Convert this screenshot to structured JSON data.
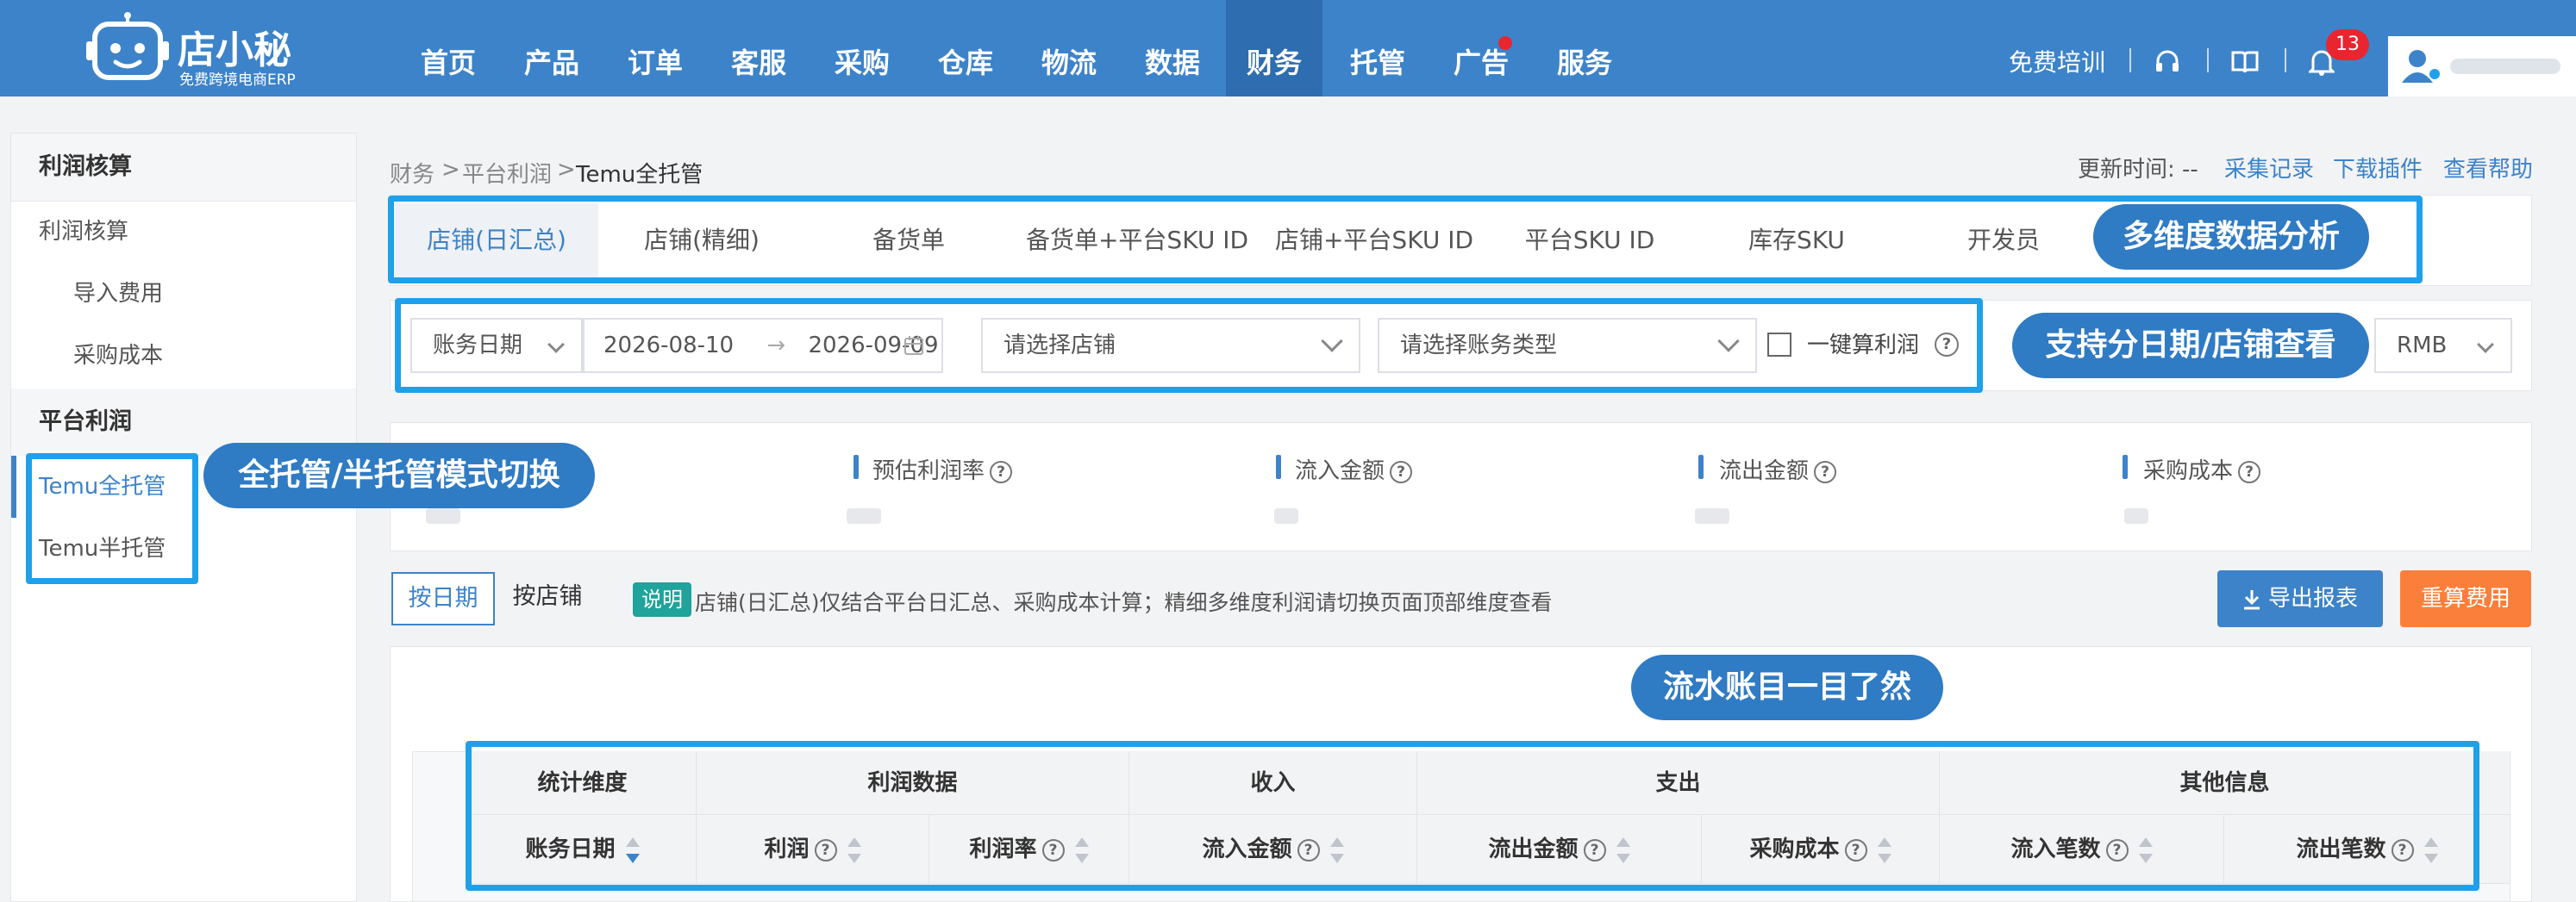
{
  "app": {
    "logo_title": "店小秘",
    "logo_subtitle": "免费跨境电商ERP"
  },
  "nav": {
    "items": [
      "首页",
      "产品",
      "订单",
      "客服",
      "采购",
      "仓库",
      "物流",
      "数据",
      "财务",
      "托管",
      "广告",
      "服务"
    ],
    "active": "财务"
  },
  "topbar": {
    "training": "免费培训",
    "notification_count": "13"
  },
  "sidebar": {
    "section1": "利润核算",
    "items1": [
      "利润核算",
      "导入费用",
      "采购成本"
    ],
    "section2": "平台利润",
    "items2": [
      "Temu全托管",
      "Temu半托管"
    ]
  },
  "breadcrumb": {
    "l1": "财务",
    "l2": "平台利润",
    "current": "Temu全托管",
    "sep": ">"
  },
  "meta": {
    "update_time": "更新时间: --",
    "links": [
      "采集记录",
      "下载插件",
      "查看帮助"
    ]
  },
  "tabs": [
    "店铺(日汇总)",
    "店铺(精细)",
    "备货单",
    "备货单+平台SKU ID",
    "店铺+平台SKU ID",
    "平台SKU ID",
    "库存SKU",
    "开发员"
  ],
  "filters": {
    "date_type": "账务日期",
    "date_start": "2026-08-10",
    "date_end": "2026-09-09",
    "arrow": "→",
    "store_placeholder": "请选择店铺",
    "account_placeholder": "请选择账务类型",
    "one_click": "一键算利润",
    "currency": "RMB"
  },
  "stats": [
    "预估利润率",
    "流入金额",
    "流出金额",
    "采购成本"
  ],
  "view_toggle": {
    "by_date": "按日期",
    "by_store": "按店铺"
  },
  "note": {
    "tag": "说明",
    "text": "店铺(日汇总)仅结合平台日汇总、采购成本计算；精细多维度利润请切换页面顶部维度查看"
  },
  "buttons": {
    "export": "导出报表",
    "recalc": "重算费用"
  },
  "table": {
    "groups": [
      "统计维度",
      "利润数据",
      "收入",
      "支出",
      "其他信息"
    ],
    "columns": [
      "账务日期",
      "利润",
      "利润率",
      "流入金额",
      "流出金额",
      "采购成本",
      "流入笔数",
      "流出笔数"
    ]
  },
  "annotations": {
    "multi_dim": "多维度数据分析",
    "by_date_store": "支持分日期/店铺查看",
    "mode_switch": "全托管/半托管模式切换",
    "ledger": "流水账目一目了然"
  },
  "colors": {
    "brand": "#3d83c9",
    "highlight": "#1fa0ea",
    "export_btn": "#3d83c9",
    "recalc_btn": "#fa7f3b",
    "badge": "#e9252f"
  }
}
